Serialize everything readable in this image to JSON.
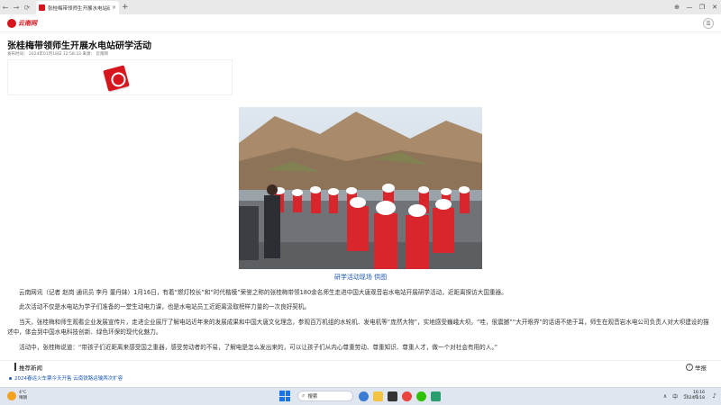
{
  "browser": {
    "tab_title": "张桂梅带领师生开展水电站研学",
    "tab_close": "×",
    "new_tab": "+",
    "nav_back": "←",
    "nav_forward": "→",
    "nav_reload": "⟳",
    "win_globe": "⊕",
    "win_min": "—",
    "win_max": "❐",
    "win_close": "✕"
  },
  "site": {
    "logo_text": "云南网",
    "menu_icon": "☰"
  },
  "article": {
    "title": "张桂梅带领师生开展水电站研学活动",
    "meta": "发布时间：  2024年01月18日 12:58:33  来源：  云南网",
    "photo_caption": "研学活动现场  供图",
    "paragraphs": [
      "云南网讯（记者 赵岗 通讯员 李丹 董丹妹）1月16日，有着“燃灯校长”和“时代楷模”荣誉之称的张桂梅带领180余名师生走进中国大唐观音岩水电站开展研学活动，近距离探访大国重器。",
      "此次活动不仅是水电站为学子们准备的一堂生动电力课，也是水电站员工近距离汲取榜样力量的一次良好契机。",
      "当天，张桂梅和师生观看企业发展宣传片，走进企业展厅了解电站近年来的发展成果和中国大唐文化理念，参观百万机组的水轮机、发电机等“庞然大物”，实地感受巍峨大坝。“哇，很震撼”“大开眼界”的话语不绝于耳，师生在观音岩水电公司负责人对大坝建设的描述中，体会到中国水电科技创新、绿色环保的现代化魅力。",
      "活动中，张桂梅说道：“带孩子们近距离来感受国之重器，感受劳动者的不易，了解电是怎么发出来的，可以让孩子们从内心尊重劳动、尊重知识、尊重人才，做一个对社会有用的人。”"
    ]
  },
  "recommend": {
    "section_title": "推荐新闻",
    "report_label": "举报",
    "report_icon": "!",
    "items": [
      "2024春运火车票今天开售 云南铁路运输两次扩容"
    ]
  },
  "taskbar": {
    "weather_temp": "4°C",
    "weather_desc": "晴朗",
    "search_label": "搜索",
    "search_icon": "⌕",
    "tray_up": "∧",
    "tray_lang": "中",
    "tray_wifi": "◠",
    "tray_volume": "◁",
    "clock_time": "16:16",
    "clock_date": "2024/1/18",
    "bell_icon": "♪"
  },
  "colors": {
    "brand_red": "#d6151d",
    "link_blue": "#1a57b5"
  }
}
